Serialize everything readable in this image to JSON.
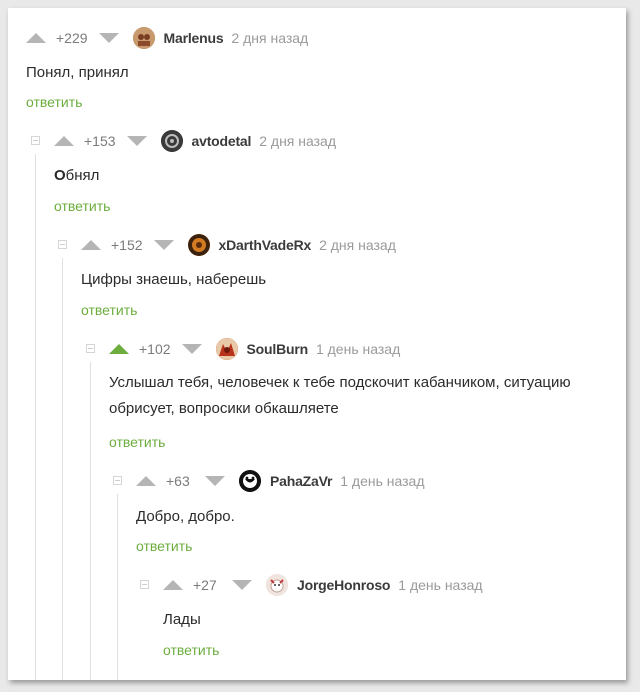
{
  "comments": [
    {
      "rating": "+229",
      "username": "Marlenus",
      "time": "2 дня назад",
      "text": "Понял, принял",
      "reply": "ответить",
      "voted_up": false,
      "avatar_color": "#a86b4a"
    },
    {
      "rating": "+153",
      "username": "avtodetal",
      "time": "2 дня назад",
      "text_bold": "О",
      "text": "бнял",
      "reply": "ответить",
      "voted_up": false,
      "avatar_color": "#2e2e2e"
    },
    {
      "rating": "+152",
      "username": "xDarthVadeRx",
      "time": "2 дня назад",
      "text": "Цифры знаешь, наберешь",
      "reply": "ответить",
      "voted_up": false,
      "avatar_color": "#b5611c"
    },
    {
      "rating": "+102",
      "username": "SoulBurn",
      "time": "1 день назад",
      "text_line1": "Услышал тебя, человечек к тебе подскочит кабанчиком, ситуацию",
      "text_line2": "обрисует, вопросики обкашляете",
      "reply": "ответить",
      "voted_up": true,
      "avatar_color": "#b23a24"
    },
    {
      "rating": "+63",
      "username": "PahaZaVr",
      "time": "1 день назад",
      "text": "Добро, добро.",
      "reply": "ответить",
      "voted_up": false,
      "avatar_color": "#111111"
    },
    {
      "rating": "+27",
      "username": "JorgeHonroso",
      "time": "1 день назад",
      "text": "Лады",
      "reply": "ответить",
      "voted_up": false,
      "avatar_color": "#e8d7d0"
    }
  ],
  "colors": {
    "accent": "#6cad3e",
    "muted": "#9a9a9a"
  }
}
